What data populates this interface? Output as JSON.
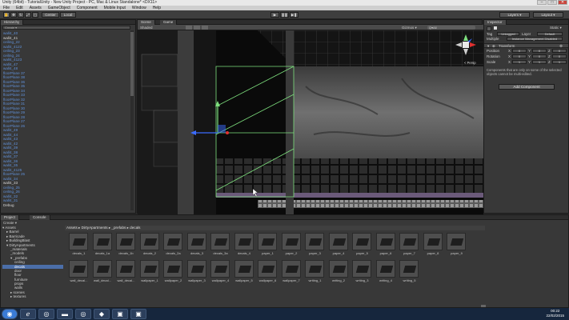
{
  "window": {
    "title": "Unity (64bit) - TutorialUnity - New Unity Project - PC, Mac & Linux Standalone* <DX11>",
    "min": "–",
    "max": "□",
    "close": "✕"
  },
  "menu": [
    "File",
    "Edit",
    "Assets",
    "GameObject",
    "Component",
    "Mobile Input",
    "Window",
    "Help"
  ],
  "toolbar": {
    "center_label": "Center",
    "local_label": "Local",
    "play": "▶",
    "pause": "❚❚",
    "step": "▶❚",
    "layers": "Layers",
    "layout": "Layout"
  },
  "hierarchy": {
    "tab": "Hierarchy",
    "create": "Create ▾",
    "items": [
      {
        "label": "wall4_40",
        "style": "blue"
      },
      {
        "label": "wall4_41",
        "style": "white"
      },
      {
        "label": "ceiling_22",
        "style": "blue"
      },
      {
        "label": "wall4_4122",
        "style": "blue"
      },
      {
        "label": "ceiling_23",
        "style": "blue"
      },
      {
        "label": "ceiling_24",
        "style": "blue"
      },
      {
        "label": "wall4_4123",
        "style": "blue"
      },
      {
        "label": "wall4_47",
        "style": "blue"
      },
      {
        "label": "wall4_48",
        "style": "blue"
      },
      {
        "label": "floorPlane 37",
        "style": "blue"
      },
      {
        "label": "floorPlane 38",
        "style": "blue"
      },
      {
        "label": "floorPlane 36",
        "style": "blue"
      },
      {
        "label": "floorPlane 35",
        "style": "blue"
      },
      {
        "label": "floorPlane 34",
        "style": "blue"
      },
      {
        "label": "floorPlane 33",
        "style": "blue"
      },
      {
        "label": "floorPlane 32",
        "style": "blue"
      },
      {
        "label": "floorPlane 31",
        "style": "blue"
      },
      {
        "label": "floorPlane 30",
        "style": "blue"
      },
      {
        "label": "floorPlane 29",
        "style": "blue"
      },
      {
        "label": "floorPlane 28",
        "style": "blue"
      },
      {
        "label": "floorPlane 27",
        "style": "blue"
      },
      {
        "label": "floorPlane 26",
        "style": "blue"
      },
      {
        "label": "wall4_49",
        "style": "blue"
      },
      {
        "label": "wall4_44",
        "style": "blue"
      },
      {
        "label": "wall4_43",
        "style": "blue"
      },
      {
        "label": "wall4_42",
        "style": "blue"
      },
      {
        "label": "wall4_39",
        "style": "blue"
      },
      {
        "label": "wall4_38",
        "style": "blue"
      },
      {
        "label": "wall4_37",
        "style": "blue"
      },
      {
        "label": "wall4_36",
        "style": "blue"
      },
      {
        "label": "wall4_35",
        "style": "blue"
      },
      {
        "label": "wall4_4125",
        "style": "blue"
      },
      {
        "label": "floorPlane 25",
        "style": "blue"
      },
      {
        "label": "wall4_34",
        "style": "blue"
      },
      {
        "label": "wall4_33",
        "style": "white"
      },
      {
        "label": "ceiling_25",
        "style": "blue"
      },
      {
        "label": "ceiling_26",
        "style": "blue"
      },
      {
        "label": "wall4_32",
        "style": "blue"
      },
      {
        "label": "wall4_31",
        "style": "blue"
      },
      {
        "label": "Debug",
        "style": "white"
      }
    ]
  },
  "scene": {
    "tab_scene": "Scene",
    "tab_game": "Game",
    "shading": "Shaded",
    "gizmos": "Gizmos ▾",
    "search": "Q▾All",
    "persp": "< Persp"
  },
  "inspector": {
    "tab": "Inspector",
    "static_label": "Static ▾",
    "tag_label": "Tag",
    "tag_value": "Untagged",
    "layer_label": "Layer",
    "layer_value": "Default",
    "multiple": "Multiple",
    "multiple_value": "Instance Management Disabled",
    "transform": "Transform",
    "position": "Position",
    "rotation": "Rotation",
    "scale": "Scale",
    "x": "X",
    "y": "Y",
    "z": "Z",
    "pos_x": "0",
    "pos_y": "0",
    "pos_z": "0",
    "rot_x": "0",
    "rot_y": "0",
    "rot_z": "0",
    "scl_x": "1",
    "scl_y": "1",
    "scl_z": "1",
    "note": "Components that are only on some of the selected objects cannot be multi-edited.",
    "add_component": "Add Component"
  },
  "project": {
    "tab_project": "Project",
    "tab_console": "Console",
    "create": "Create ▾",
    "tree": [
      {
        "label": "▾ Assets",
        "indent": 0
      },
      {
        "label": "▸ Barrel",
        "indent": 1
      },
      {
        "label": "▸ Barricade",
        "indent": 1
      },
      {
        "label": "▸ BuildingBlast",
        "indent": 1
      },
      {
        "label": "▾ DirtyApartments",
        "indent": 1
      },
      {
        "label": "_materials",
        "indent": 2
      },
      {
        "label": "_models",
        "indent": 2
      },
      {
        "label": "▾ _prefabs",
        "indent": 2
      },
      {
        "label": "ceiling",
        "indent": 3
      },
      {
        "label": "decals",
        "indent": 3,
        "selected": true
      },
      {
        "label": "door",
        "indent": 3
      },
      {
        "label": "floor",
        "indent": 3
      },
      {
        "label": "furniture",
        "indent": 3
      },
      {
        "label": "props",
        "indent": 3
      },
      {
        "label": "walls",
        "indent": 3
      },
      {
        "label": "▸ scenes",
        "indent": 2
      },
      {
        "label": "▸ textures",
        "indent": 2
      }
    ],
    "path": "Assets ▸ DirtyApartments ▸ _prefabs ▸ decals",
    "row1": [
      "decals_1",
      "decals_1a",
      "decals_1b",
      "decals_2",
      "decals_2a",
      "decals_3",
      "decals_3a",
      "decals_4",
      "paper_1",
      "paper_2",
      "paper_3",
      "paper_4",
      "paper_5",
      "paper_6",
      "paper_7",
      "paper_8",
      "paper_9"
    ],
    "row2": [
      "wall_decal...",
      "wall_decal...",
      "wall_decal...",
      "wallpaper_1",
      "wallpaper_2",
      "wallpaper_3",
      "wallpaper_4",
      "wallpaper_5",
      "wallpaper_6",
      "wallpaper_7",
      "writing_1",
      "writing_2",
      "writing_3",
      "writing_4",
      "writing_5"
    ]
  },
  "taskbar": {
    "icons": [
      "windows-start-icon",
      "ie-icon",
      "chrome-icon",
      "folder-icon",
      "chrome-icon",
      "unity-icon",
      "app-icon",
      "app-icon"
    ],
    "icon_glyphs": [
      "◉",
      "ℯ",
      "◎",
      "▬",
      "◎",
      "◆",
      "▣",
      "▣"
    ],
    "time": "00:22",
    "date": "22/02/2015"
  }
}
